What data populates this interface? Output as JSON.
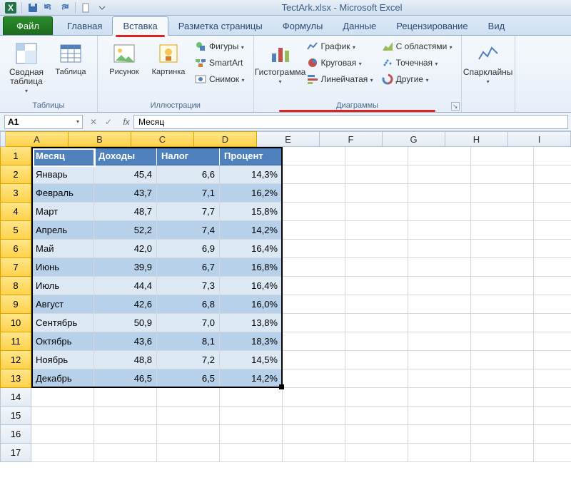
{
  "app": {
    "title": "TectArk.xlsx - Microsoft Excel"
  },
  "tabs": {
    "file": "Файл",
    "items": [
      "Главная",
      "Вставка",
      "Разметка страницы",
      "Формулы",
      "Данные",
      "Рецензирование",
      "Вид"
    ],
    "active": "Вставка"
  },
  "ribbon": {
    "tables": {
      "label": "Таблицы",
      "pivot": "Сводная\nтаблица",
      "table": "Таблица"
    },
    "illustrations": {
      "label": "Иллюстрации",
      "picture": "Рисунок",
      "clipart": "Картинка",
      "shapes": "Фигуры",
      "smartart": "SmartArt",
      "screenshot": "Снимок"
    },
    "charts": {
      "label": "Диаграммы",
      "column": "Гистограмма",
      "line": "График",
      "pie": "Круговая",
      "bar": "Линейчатая",
      "area": "С областями",
      "scatter": "Точечная",
      "other": "Другие"
    },
    "sparklines": {
      "label": "",
      "spark": "Спарклайны"
    }
  },
  "formula_bar": {
    "name_box": "A1",
    "formula": "Месяц"
  },
  "grid": {
    "columns": [
      "A",
      "B",
      "C",
      "D",
      "E",
      "F",
      "G",
      "H",
      "I"
    ],
    "selected_cols": [
      "A",
      "B",
      "C",
      "D"
    ],
    "row_count": 17,
    "selected_rows": 13,
    "headers": [
      "Месяц",
      "Доходы",
      "Налог",
      "Процент"
    ],
    "rows": [
      {
        "m": "Январь",
        "d": "45,4",
        "n": "6,6",
        "p": "14,3%"
      },
      {
        "m": "Февраль",
        "d": "43,7",
        "n": "7,1",
        "p": "16,2%"
      },
      {
        "m": "Март",
        "d": "48,7",
        "n": "7,7",
        "p": "15,8%"
      },
      {
        "m": "Апрель",
        "d": "52,2",
        "n": "7,4",
        "p": "14,2%"
      },
      {
        "m": "Май",
        "d": "42,0",
        "n": "6,9",
        "p": "16,4%"
      },
      {
        "m": "Июнь",
        "d": "39,9",
        "n": "6,7",
        "p": "16,8%"
      },
      {
        "m": "Июль",
        "d": "44,4",
        "n": "7,3",
        "p": "16,4%"
      },
      {
        "m": "Август",
        "d": "42,6",
        "n": "6,8",
        "p": "16,0%"
      },
      {
        "m": "Сентябрь",
        "d": "50,9",
        "n": "7,0",
        "p": "13,8%"
      },
      {
        "m": "Октябрь",
        "d": "43,6",
        "n": "8,1",
        "p": "18,3%"
      },
      {
        "m": "Ноябрь",
        "d": "48,8",
        "n": "7,2",
        "p": "14,5%"
      },
      {
        "m": "Декабрь",
        "d": "46,5",
        "n": "6,5",
        "p": "14,2%"
      }
    ]
  },
  "chart_data": {
    "type": "table",
    "title": "Доходы/Налог/Процент по месяцам",
    "columns": [
      "Месяц",
      "Доходы",
      "Налог",
      "Процент"
    ],
    "rows": [
      [
        "Январь",
        45.4,
        6.6,
        0.143
      ],
      [
        "Февраль",
        43.7,
        7.1,
        0.162
      ],
      [
        "Март",
        48.7,
        7.7,
        0.158
      ],
      [
        "Апрель",
        52.2,
        7.4,
        0.142
      ],
      [
        "Май",
        42.0,
        6.9,
        0.164
      ],
      [
        "Июнь",
        39.9,
        6.7,
        0.168
      ],
      [
        "Июль",
        44.4,
        7.3,
        0.164
      ],
      [
        "Август",
        42.6,
        6.8,
        0.16
      ],
      [
        "Сентябрь",
        50.9,
        7.0,
        0.138
      ],
      [
        "Октябрь",
        43.6,
        8.1,
        0.183
      ],
      [
        "Ноябрь",
        48.8,
        7.2,
        0.145
      ],
      [
        "Декабрь",
        46.5,
        6.5,
        0.142
      ]
    ]
  }
}
